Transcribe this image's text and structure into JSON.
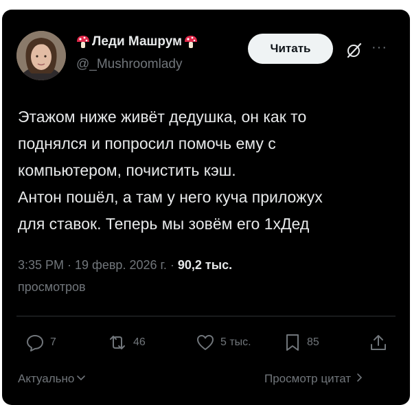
{
  "author": {
    "display_name": "Леди Машрум",
    "handle": "@_Mushroomlady"
  },
  "header": {
    "read_label": "Читать",
    "more_label": "···"
  },
  "post": {
    "lines": [
      "Этажом ниже живёт дедушка, он как то",
      "поднялся и попросил помочь ему с",
      "компьютером, почистить кэш.",
      "Антон пошёл, а там у него куча приложух",
      "для ставок. Теперь мы зовём его 1хДед"
    ]
  },
  "meta": {
    "time_date": "3:35 PM · 19 февр. 2026 г. · ",
    "views_count": "90,2 тыс.",
    "views_label": "просмотров"
  },
  "actions": {
    "replies": "7",
    "reposts": "46",
    "likes": "5 тыс.",
    "bookmarks": "85"
  },
  "footer": {
    "sort_label": "Актуально",
    "quotes_label": "Просмотр цитат"
  },
  "colors": {
    "background": "#000000",
    "text_primary": "#e7e9ea",
    "text_secondary": "#71767b",
    "button_bg": "#eff3f4"
  }
}
